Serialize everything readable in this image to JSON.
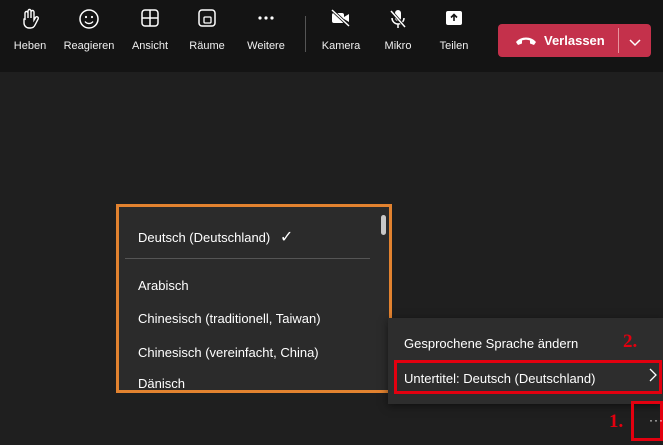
{
  "toolbar": {
    "raise_hand_label": "Heben",
    "react_label": "Reagieren",
    "view_label": "Ansicht",
    "rooms_label": "Räume",
    "more_label": "Weitere",
    "camera_label": "Kamera",
    "mic_label": "Mikro",
    "share_label": "Teilen",
    "leave_label": "Verlassen",
    "leave_color": "#c4314b"
  },
  "language_menu": {
    "selected": "Deutsch (Deutschland)",
    "selected_mark": "✓",
    "items": [
      "Arabisch",
      "Chinesisch (traditionell, Taiwan)",
      "Chinesisch (vereinfacht, China)",
      "Dänisch"
    ]
  },
  "captions_menu": {
    "change_spoken_language": "Gesprochene Sprache ändern",
    "subtitles_item": "Untertitel: Deutsch (Deutschland)",
    "chevron": "›"
  },
  "annotations": {
    "step1": "1.",
    "step2": "2.",
    "highlight_orange": "#e2822f",
    "highlight_red": "#e3000f"
  },
  "more_button_glyph": "···"
}
